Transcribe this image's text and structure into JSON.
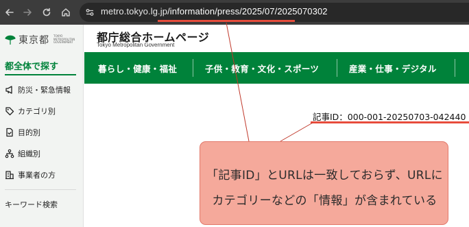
{
  "browser": {
    "url_host": "metro.tokyo.lg.jp",
    "url_path": "/information/press/2025/07/2025070302",
    "underline_color": "#e74c3c"
  },
  "site": {
    "logo_text": "東京都",
    "logo_small_lines": [
      "TOKYO",
      "METROPOLITAN",
      "GOVERNMENT"
    ],
    "title": "都庁総合ホームページ",
    "subtitle": "Tokyo Metropolitan Government",
    "brand_color": "#00823a"
  },
  "sidebar": {
    "heading": "都全体で探す",
    "items": [
      {
        "label": "防災・緊急情報",
        "icon": "megaphone-icon"
      },
      {
        "label": "カテゴリ別",
        "icon": "tag-icon"
      },
      {
        "label": "目的別",
        "icon": "document-check-icon"
      },
      {
        "label": "組織別",
        "icon": "org-chart-icon"
      },
      {
        "label": "事業者の方",
        "icon": "building-icon"
      }
    ],
    "keyword_search": "キーワード検索"
  },
  "gnav": {
    "items": [
      "暮らし・健康・福祉",
      "子供・教育・文化・スポーツ",
      "産業・仕事・デジタル"
    ]
  },
  "article": {
    "id_label": "記事ID：000-001-20250703-042440"
  },
  "callout": {
    "line1": "「記事ID」とURLは一致しておらず、URLに",
    "line2": "カテゴリーなどの「情報」が含まれている",
    "fill": "#f5a99b",
    "border": "#e2786a"
  }
}
